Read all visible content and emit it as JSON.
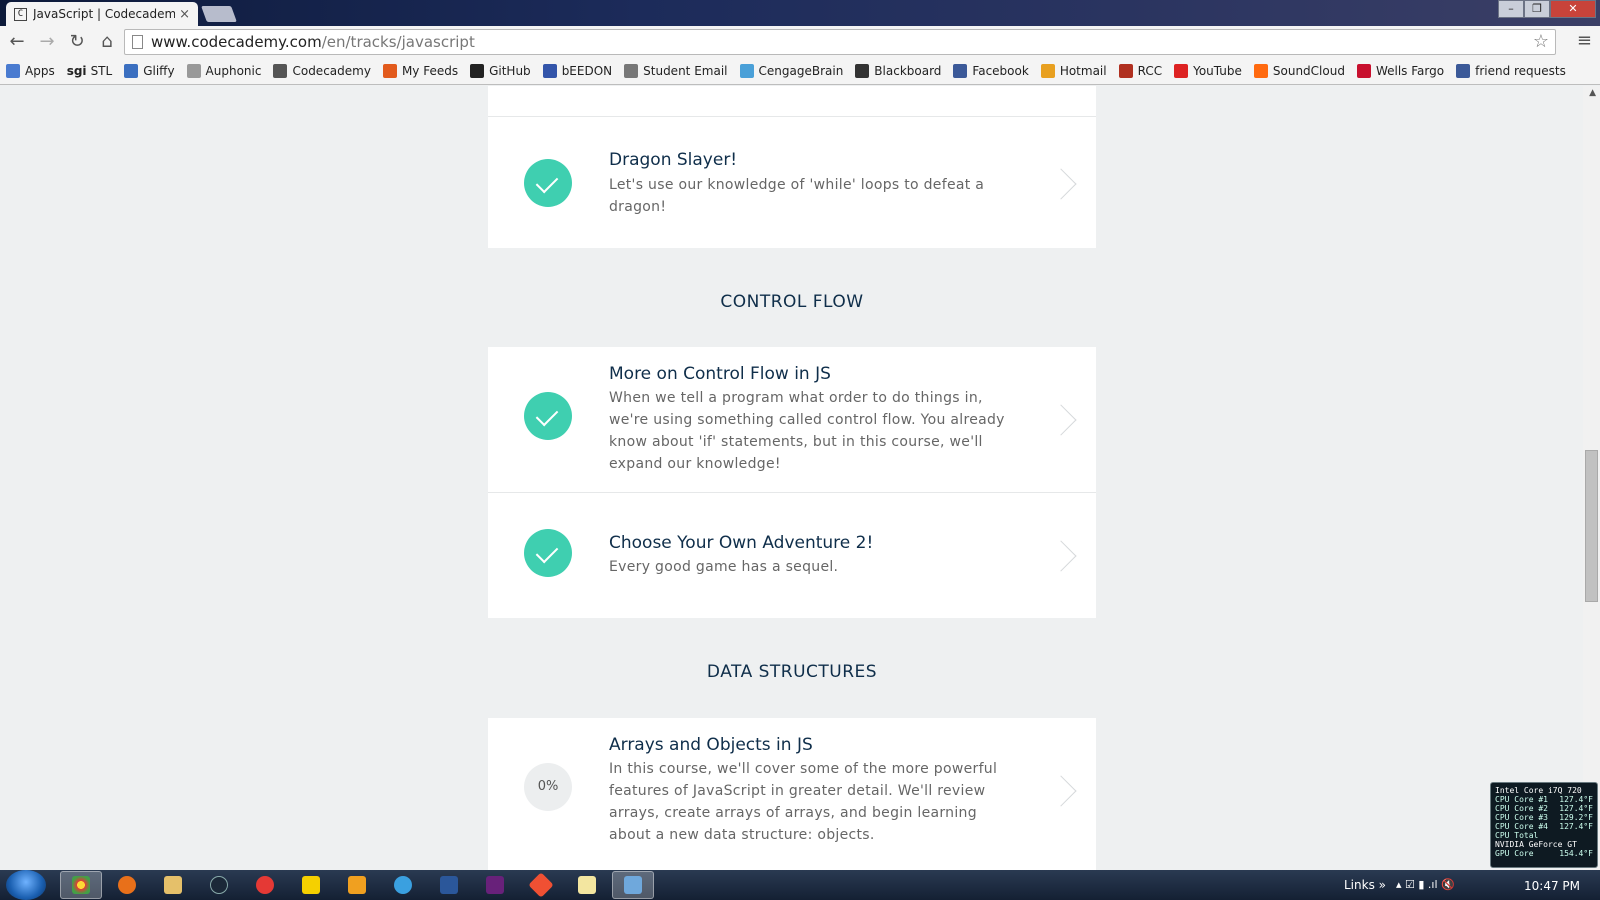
{
  "window": {
    "tab_title": "JavaScript | Codecademy",
    "tab_favicon": "C",
    "tab_close": "×",
    "minimize": "–",
    "maximize": "❐",
    "close": "✕"
  },
  "toolbar": {
    "back": "←",
    "forward": "→",
    "reload": "↻",
    "home": "⌂",
    "url_host": "www.codecademy.com",
    "url_path": "/en/tracks/javascript",
    "star": "☆",
    "menu": "≡"
  },
  "bookmarks": [
    {
      "label": "Apps",
      "color": "#4a7bd0"
    },
    {
      "label": "STL",
      "prefix": "sgi",
      "color": ""
    },
    {
      "label": "Gliffy",
      "color": "#3b6fc0"
    },
    {
      "label": "Auphonic",
      "color": "#999999"
    },
    {
      "label": "Codecademy",
      "color": "#555555"
    },
    {
      "label": "My Feeds",
      "color": "#e25a1c"
    },
    {
      "label": "GitHub",
      "color": "#222222"
    },
    {
      "label": "bEEDON",
      "color": "#3355aa"
    },
    {
      "label": "Student Email",
      "color": "#777777"
    },
    {
      "label": "CengageBrain",
      "color": "#4aa0d8"
    },
    {
      "label": "Blackboard",
      "color": "#333333"
    },
    {
      "label": "Facebook",
      "color": "#3b5998"
    },
    {
      "label": "Hotmail",
      "color": "#e8a020"
    },
    {
      "label": "RCC",
      "color": "#b03020"
    },
    {
      "label": "YouTube",
      "color": "#dd2222"
    },
    {
      "label": "SoundCloud",
      "color": "#ff6a10"
    },
    {
      "label": "Wells Fargo",
      "color": "#c8102e"
    },
    {
      "label": "friend requests",
      "color": "#3b5998"
    }
  ],
  "sections": {
    "control_flow": "CONTROL FLOW",
    "data_structures": "DATA STRUCTURES"
  },
  "courses": [
    {
      "title": "Dragon Slayer!",
      "description": "Let's use our knowledge of 'while' loops to defeat a dragon!",
      "status": "complete"
    },
    {
      "title": "More on Control Flow in JS",
      "description": "When we tell a program what order to do things in, we're using something called control flow. You already know about 'if' statements, but in this course, we'll expand our knowledge!",
      "status": "complete"
    },
    {
      "title": "Choose Your Own Adventure 2!",
      "description": "Every good game has a sequel.",
      "status": "complete"
    },
    {
      "title": "Arrays and Objects in JS",
      "description": "In this course, we'll cover some of the more powerful features of JavaScript in greater detail. We'll review arrays, create arrays of arrays, and begin learning about a new data structure: objects.",
      "status": "in-progress",
      "progress_label": "0%",
      "progress": 0
    }
  ],
  "taskbar": {
    "links": "Links",
    "links_chevron": "»",
    "clock": "10:47 PM"
  },
  "gadget": {
    "title": "Intel Core i7Q 720",
    "rows": [
      {
        "label": "CPU Core #1",
        "value": "127.4°F"
      },
      {
        "label": "CPU Core #2",
        "value": "127.4°F"
      },
      {
        "label": "CPU Core #3",
        "value": "129.2°F"
      },
      {
        "label": "CPU Core #4",
        "value": "127.4°F"
      },
      {
        "label": "CPU Total",
        "value": ""
      }
    ],
    "gpu_title": "NVIDIA GeForce GT",
    "gpu_row": {
      "label": "GPU Core",
      "value": "154.4°F"
    }
  },
  "colors": {
    "accent_teal": "#3fcfb0",
    "heading_navy": "#0f2e4a",
    "page_bg": "#eef0f1"
  }
}
